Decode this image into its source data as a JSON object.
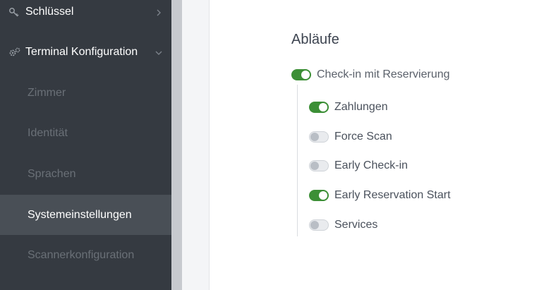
{
  "sidebar": {
    "items": [
      {
        "label": "Schlüssel",
        "icon": "key-icon"
      },
      {
        "label": "Terminal Konfiguration",
        "icon": "gears-icon"
      }
    ],
    "subitems": [
      {
        "label": "Zimmer"
      },
      {
        "label": "Identität"
      },
      {
        "label": "Sprachen"
      },
      {
        "label": "Systemeinstellungen"
      },
      {
        "label": "Scannerkonfiguration"
      }
    ]
  },
  "main": {
    "section_title": "Abläufe",
    "primary": {
      "label": "Check-in mit Reservierung",
      "enabled": true
    },
    "options": [
      {
        "label": "Zahlungen",
        "enabled": true
      },
      {
        "label": "Force Scan",
        "enabled": false
      },
      {
        "label": "Early Check-in",
        "enabled": false
      },
      {
        "label": "Early Reservation Start",
        "enabled": true
      },
      {
        "label": "Services",
        "enabled": false
      }
    ]
  },
  "colors": {
    "sidebar_bg": "#353a41",
    "active_bg": "#494f56",
    "toggle_on": "#3c8f36"
  }
}
